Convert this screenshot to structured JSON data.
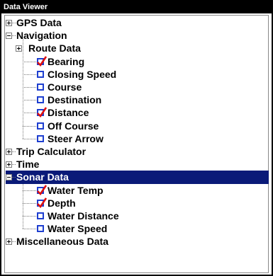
{
  "window": {
    "title": "Data Viewer"
  },
  "tree": [
    {
      "id": "gps-data",
      "label": "GPS Data",
      "level": 0,
      "expander": "plus"
    },
    {
      "id": "navigation",
      "label": "Navigation",
      "level": 0,
      "expander": "minus"
    },
    {
      "id": "route-data",
      "label": "Route Data",
      "level": 1,
      "expander": "plus"
    },
    {
      "id": "bearing",
      "label": "Bearing",
      "level": 2,
      "checked": true
    },
    {
      "id": "closing-speed",
      "label": "Closing Speed",
      "level": 2,
      "checked": false
    },
    {
      "id": "course",
      "label": "Course",
      "level": 2,
      "checked": false
    },
    {
      "id": "destination",
      "label": "Destination",
      "level": 2,
      "checked": false
    },
    {
      "id": "distance",
      "label": "Distance",
      "level": 2,
      "checked": true
    },
    {
      "id": "off-course",
      "label": "Off Course",
      "level": 2,
      "checked": false
    },
    {
      "id": "steer-arrow",
      "label": "Steer Arrow",
      "level": 2,
      "checked": false
    },
    {
      "id": "trip-calculator",
      "label": "Trip Calculator",
      "level": 0,
      "expander": "plus"
    },
    {
      "id": "time",
      "label": "Time",
      "level": 0,
      "expander": "plus"
    },
    {
      "id": "sonar-data",
      "label": "Sonar Data",
      "level": 0,
      "expander": "minus",
      "selected": true
    },
    {
      "id": "water-temp",
      "label": "Water Temp",
      "level": 2,
      "checked": true
    },
    {
      "id": "depth",
      "label": "Depth",
      "level": 2,
      "checked": true
    },
    {
      "id": "water-distance",
      "label": "Water Distance",
      "level": 2,
      "checked": false
    },
    {
      "id": "water-speed",
      "label": "Water Speed",
      "level": 2,
      "checked": false
    },
    {
      "id": "miscellaneous-data",
      "label": "Miscellaneous Data",
      "level": 0,
      "expander": "plus"
    }
  ],
  "colors": {
    "selection": "#0a1a78",
    "checkbox": "#1e3fd0",
    "checkmark": "#e01010"
  }
}
